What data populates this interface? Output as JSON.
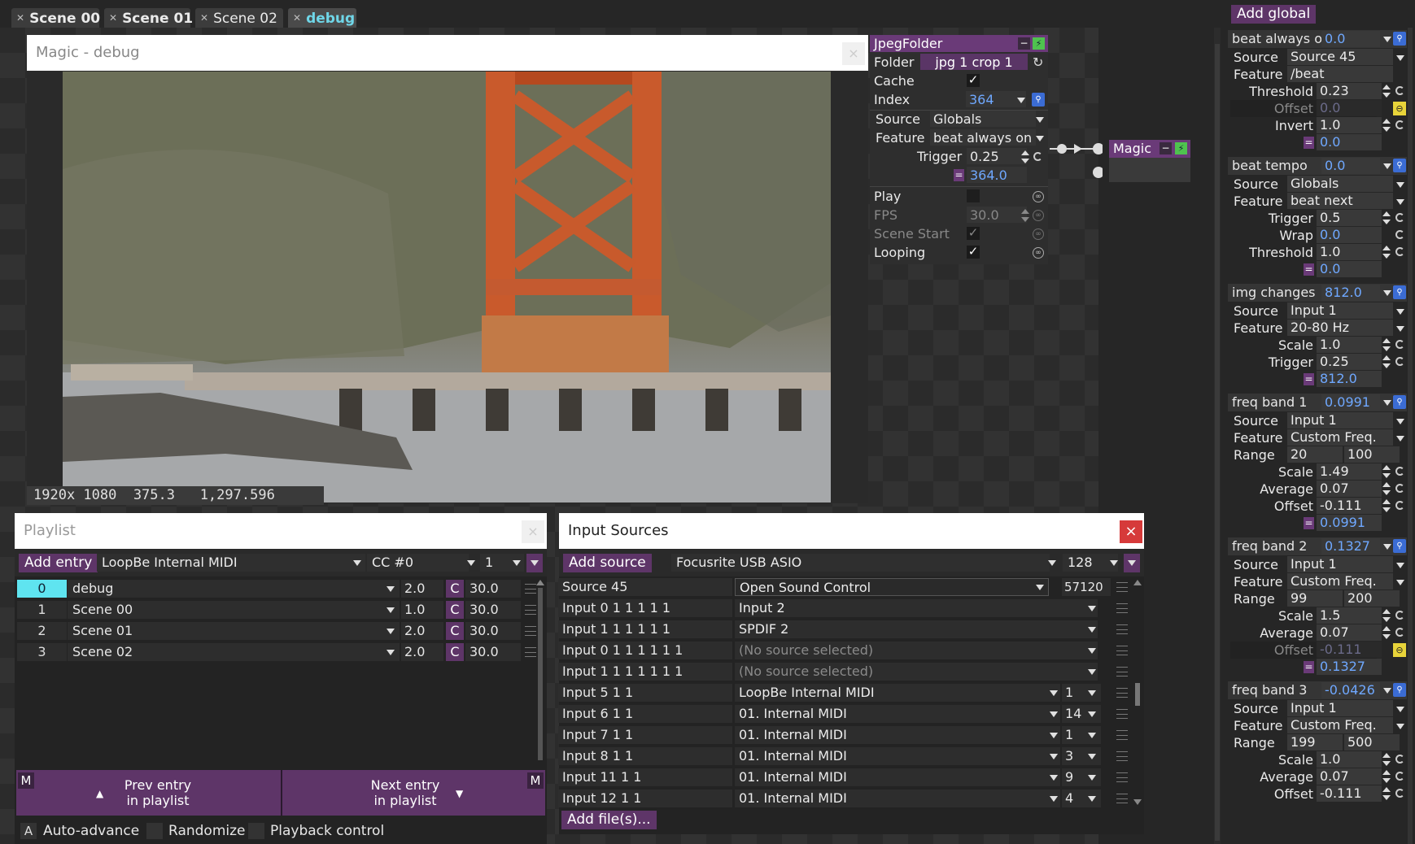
{
  "tabs": [
    {
      "label": "Scene 00"
    },
    {
      "label": "Scene 01"
    },
    {
      "label": "Scene 02"
    },
    {
      "label": "debug"
    }
  ],
  "preview": {
    "title": "Magic - debug",
    "overlay": "1920x 1080  375.3   1,297.596"
  },
  "node_jpeg": {
    "title": "JpegFolder",
    "folder_label": "Folder",
    "folder_value": "jpg 1 crop 1",
    "cache_label": "Cache",
    "index_label": "Index",
    "index_value": "364",
    "source_label": "Source",
    "source_value": "Globals",
    "feature_label": "Feature",
    "feature_value": "beat always on",
    "trigger_label": "Trigger",
    "trigger_value": "0.25",
    "eq_value": "364.0",
    "play_label": "Play",
    "fps_label": "FPS",
    "fps_value": "30.0",
    "scene_start_label": "Scene Start",
    "looping_label": "Looping"
  },
  "node_magic": {
    "title": "Magic"
  },
  "playlist": {
    "title": "Playlist",
    "add_entry": "Add entry",
    "midi_device": "LoopBe Internal MIDI",
    "cc": "CC #0",
    "channel": "1",
    "rows": [
      {
        "index": "0",
        "name": "debug",
        "time": "2.0",
        "c": "C",
        "duration": "30.0"
      },
      {
        "index": "1",
        "name": "Scene 00",
        "time": "1.0",
        "c": "C",
        "duration": "30.0"
      },
      {
        "index": "2",
        "name": "Scene 01",
        "time": "2.0",
        "c": "C",
        "duration": "30.0"
      },
      {
        "index": "3",
        "name": "Scene 02",
        "time": "2.0",
        "c": "C",
        "duration": "30.0"
      }
    ],
    "m_left": "M",
    "m_right": "M",
    "prev_line1": "Prev entry",
    "prev_line2": "in playlist",
    "next_line1": "Next entry",
    "next_line2": "in playlist",
    "auto_key": "A",
    "auto_advance": "Auto-advance",
    "randomize": "Randomize",
    "playback_control": "Playback control"
  },
  "inputs": {
    "title": "Input Sources",
    "close": "×",
    "add_source": "Add source",
    "device": "Focusrite USB ASIO",
    "buffer": "128",
    "rows": [
      {
        "name": "Source 45",
        "source": "Open Sound Control",
        "extra": "57120"
      },
      {
        "name": "Input 0 1 1 1 1 1",
        "source": "Input 2",
        "extra": ""
      },
      {
        "name": "Input 1 1 1 1 1 1",
        "source": "SPDIF 2",
        "extra": ""
      },
      {
        "name": "Input 0 1 1 1 1 1 1",
        "source": "(No source selected)",
        "extra": ""
      },
      {
        "name": "Input 1 1 1 1 1 1 1",
        "source": "(No source selected)",
        "extra": ""
      },
      {
        "name": "Input 5 1 1",
        "source": "LoopBe Internal MIDI",
        "extra": "1"
      },
      {
        "name": "Input 6 1 1",
        "source": "01. Internal MIDI",
        "extra": "14"
      },
      {
        "name": "Input 7 1 1",
        "source": "01. Internal MIDI",
        "extra": "1"
      },
      {
        "name": "Input 8 1 1",
        "source": "01. Internal MIDI",
        "extra": "3"
      },
      {
        "name": "Input 11 1 1",
        "source": "01. Internal MIDI",
        "extra": "9"
      },
      {
        "name": "Input 12 1 1",
        "source": "01. Internal MIDI",
        "extra": "4"
      }
    ],
    "add_files": "Add file(s)..."
  },
  "globals": {
    "add_global": "Add global",
    "groups": [
      {
        "name": "beat always on",
        "value": "0.0",
        "rows": [
          {
            "label": "Source",
            "value": "Source 45",
            "kind": "select"
          },
          {
            "label": "Feature",
            "value": "/beat",
            "kind": "text"
          },
          {
            "label": "Threshold",
            "value": "0.23",
            "kind": "spin"
          },
          {
            "label": "Offset",
            "value": "0.0",
            "kind": "offset"
          },
          {
            "label": "Invert",
            "value": "1.0",
            "kind": "spin"
          },
          {
            "label": "",
            "value": "0.0",
            "kind": "eq"
          }
        ]
      },
      {
        "name": "beat tempo",
        "value": "0.0",
        "rows": [
          {
            "label": "Source",
            "value": "Globals",
            "kind": "select"
          },
          {
            "label": "Feature",
            "value": "beat next",
            "kind": "select"
          },
          {
            "label": "Trigger",
            "value": "0.5",
            "kind": "spin"
          },
          {
            "label": "Wrap",
            "value": "0.0",
            "kind": "blue"
          },
          {
            "label": "Threshold",
            "value": "1.0",
            "kind": "spin"
          },
          {
            "label": "",
            "value": "0.0",
            "kind": "eq"
          }
        ]
      },
      {
        "name": "img changes",
        "value": "812.0",
        "rows": [
          {
            "label": "Source",
            "value": "Input 1",
            "kind": "select"
          },
          {
            "label": "Feature",
            "value": "20-80 Hz",
            "kind": "select"
          },
          {
            "label": "Scale",
            "value": "1.0",
            "kind": "spin"
          },
          {
            "label": "Trigger",
            "value": "0.25",
            "kind": "spin"
          },
          {
            "label": "",
            "value": "812.0",
            "kind": "eq"
          }
        ]
      },
      {
        "name": "freq band 1",
        "value": "0.0991",
        "rows": [
          {
            "label": "Source",
            "value": "Input 1",
            "kind": "select"
          },
          {
            "label": "Feature",
            "value": "Custom Freq.",
            "kind": "select"
          },
          {
            "label": "Range",
            "value": "20",
            "value2": "100",
            "kind": "range"
          },
          {
            "label": "Scale",
            "value": "1.49",
            "kind": "spin"
          },
          {
            "label": "Average",
            "value": "0.07",
            "kind": "spin"
          },
          {
            "label": "Offset",
            "value": "-0.111",
            "kind": "spin"
          },
          {
            "label": "",
            "value": "0.0991",
            "kind": "eq"
          }
        ]
      },
      {
        "name": "freq band 2",
        "value": "0.1327",
        "rows": [
          {
            "label": "Source",
            "value": "Input 1",
            "kind": "select"
          },
          {
            "label": "Feature",
            "value": "Custom Freq.",
            "kind": "select"
          },
          {
            "label": "Range",
            "value": "99",
            "value2": "200",
            "kind": "range"
          },
          {
            "label": "Scale",
            "value": "1.5",
            "kind": "spin"
          },
          {
            "label": "Average",
            "value": "0.07",
            "kind": "spin"
          },
          {
            "label": "Offset",
            "value": "-0.111",
            "kind": "offset"
          },
          {
            "label": "",
            "value": "0.1327",
            "kind": "eq"
          }
        ]
      },
      {
        "name": "freq band 3",
        "value": "-0.0426",
        "rows": [
          {
            "label": "Source",
            "value": "Input 1",
            "kind": "select"
          },
          {
            "label": "Feature",
            "value": "Custom Freq.",
            "kind": "select"
          },
          {
            "label": "Range",
            "value": "199",
            "value2": "500",
            "kind": "range"
          },
          {
            "label": "Scale",
            "value": "1.0",
            "kind": "spin"
          },
          {
            "label": "Average",
            "value": "0.07",
            "kind": "spin"
          },
          {
            "label": "Offset",
            "value": "-0.111",
            "kind": "spin"
          }
        ]
      }
    ]
  }
}
